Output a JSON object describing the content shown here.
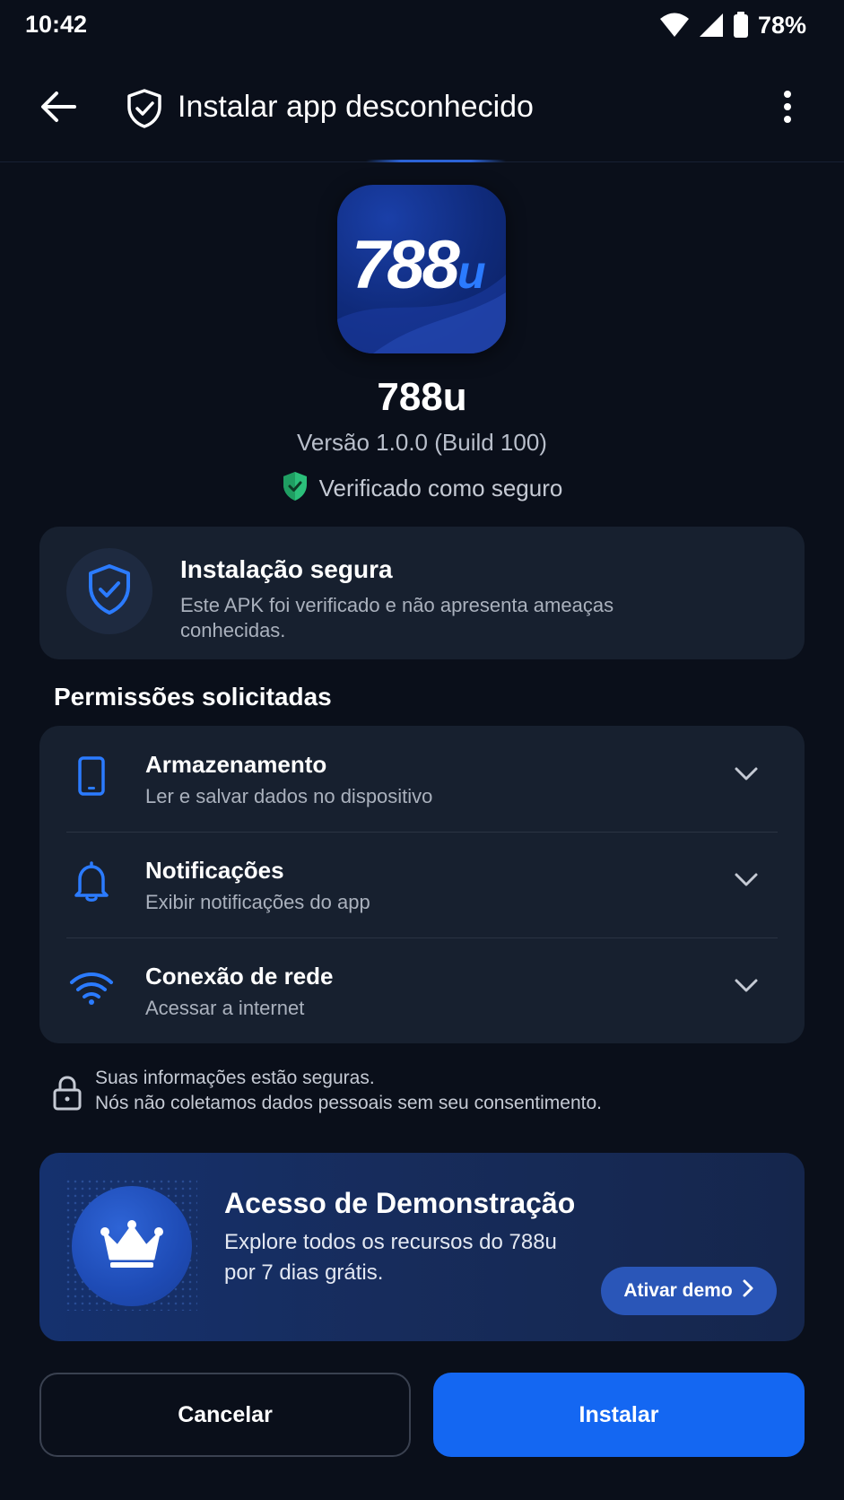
{
  "status_bar": {
    "time": "10:42",
    "battery": "78%",
    "icons": [
      "wifi-icon",
      "signal-icon",
      "battery-icon"
    ]
  },
  "app_bar": {
    "title": "Instalar app desconhecido",
    "icons": [
      "back-arrow-icon",
      "shield-check-icon",
      "more-vert-icon"
    ]
  },
  "app": {
    "icon_text": "788",
    "icon_text_suffix": "u",
    "name": "788u",
    "version": "Versão 1.0.0 (Build 100)",
    "verified": "Verificado como seguro"
  },
  "secure_card": {
    "title": "Instalação segura",
    "description": "Este APK foi verificado e não apresenta ameaças conhecidas."
  },
  "permissions": {
    "heading": "Permissões solicitadas",
    "items": [
      {
        "icon": "phone-icon",
        "title": "Armazenamento",
        "description": "Ler e salvar dados no dispositivo"
      },
      {
        "icon": "bell-icon",
        "title": "Notificações",
        "description": "Exibir notificações do app"
      },
      {
        "icon": "wifi-icon",
        "title": "Conexão de rede",
        "description": "Acessar a internet"
      }
    ]
  },
  "privacy": {
    "line1": "Suas informações estão seguras.",
    "line2": "Nós não coletamos dados pessoais sem seu consentimento."
  },
  "demo": {
    "title": "Acesso de Demonstração",
    "description_line1": "Explore todos os recursos do 788u",
    "description_line2": "por 7 dias grátis.",
    "button_label": "Ativar demo"
  },
  "actions": {
    "cancel_label": "Cancelar",
    "install_label": "Instalar"
  },
  "colors": {
    "background": "#0a0f1a",
    "card": "#17202f",
    "accent_blue": "#1467f2",
    "icon_blue": "#2b7bff",
    "verified_green": "#2bbf7a"
  }
}
